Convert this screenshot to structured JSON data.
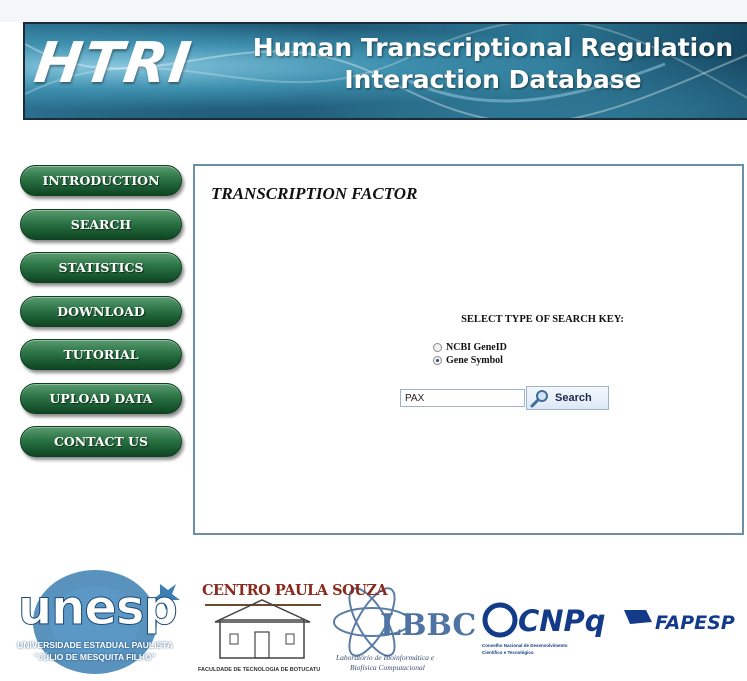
{
  "header": {
    "logo": "HTRI",
    "title": "Human Transcriptional Regulation Interaction Database"
  },
  "nav": {
    "items": [
      {
        "label": "INTRODUCTION"
      },
      {
        "label": "SEARCH"
      },
      {
        "label": "STATISTICS"
      },
      {
        "label": "DOWNLOAD"
      },
      {
        "label": "TUTORIAL"
      },
      {
        "label": "UPLOAD DATA"
      },
      {
        "label": "CONTACT US"
      }
    ]
  },
  "main": {
    "title": "TRANSCRIPTION FACTOR",
    "search_key_label": "SELECT TYPE OF SEARCH KEY:",
    "options": [
      {
        "label": "NCBI GeneID",
        "selected": false
      },
      {
        "label": "Gene Symbol",
        "selected": true
      }
    ],
    "search_value": "PAX",
    "search_button": "Search"
  },
  "footer": {
    "unesp": "unesp",
    "unesp_line1": "UNIVERSIDADE ESTADUAL PAULISTA",
    "unesp_line2": "\"JÚLIO DE MESQUITA FILHO\"",
    "centro": "CENTRO PAULA SOUZA",
    "fatec": "FACULDADE DE TECNOLOGIA DE BOTUCATU",
    "lbbc": "LBBC",
    "lbbc_sub1": "Laboratório de Bioinformática e",
    "lbbc_sub2": "Biofísica Computacional",
    "cnpq": "CNPq",
    "cnpq_sub1": "Conselho Nacional de Desenvolvimento",
    "cnpq_sub2": "Científico e Tecnológico",
    "fapesp": "FAPESP"
  },
  "colors": {
    "nav_green": "#1a5a31",
    "banner_blue": "#1d5673",
    "panel_border": "#6c8fa8"
  }
}
